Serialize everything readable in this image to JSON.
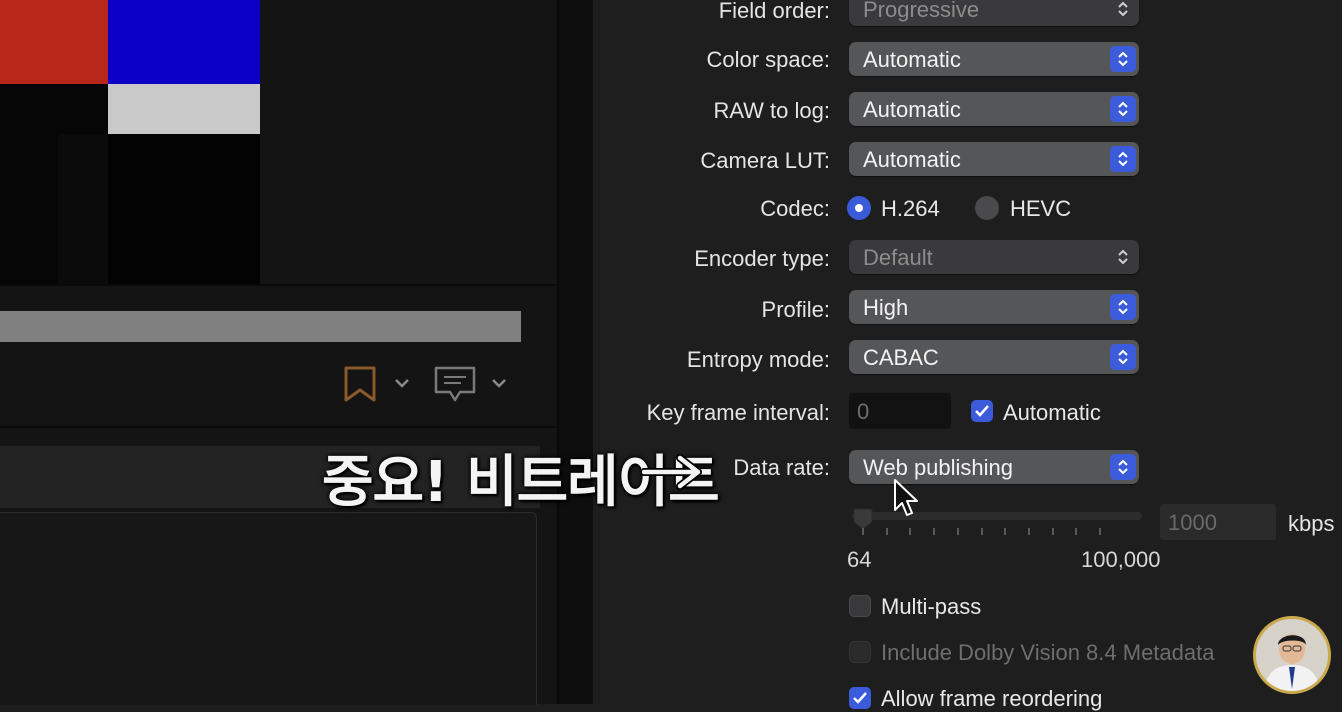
{
  "settings": {
    "field_order": {
      "label": "Field order:",
      "value": "Progressive"
    },
    "color_space": {
      "label": "Color space:",
      "value": "Automatic"
    },
    "raw_to_log": {
      "label": "RAW to log:",
      "value": "Automatic"
    },
    "camera_lut": {
      "label": "Camera LUT:",
      "value": "Automatic"
    },
    "codec": {
      "label": "Codec:",
      "options": [
        "H.264",
        "HEVC"
      ],
      "selected": "H.264"
    },
    "encoder_type": {
      "label": "Encoder type:",
      "value": "Default"
    },
    "profile": {
      "label": "Profile:",
      "value": "High"
    },
    "entropy_mode": {
      "label": "Entropy mode:",
      "value": "CABAC"
    },
    "key_frame_interval": {
      "label": "Key frame interval:",
      "value": "0",
      "automatic_label": "Automatic",
      "automatic_checked": true
    },
    "data_rate": {
      "label": "Data rate:",
      "value": "Web publishing",
      "field_value": "1000",
      "unit": "kbps",
      "min_label": "64",
      "max_label": "100,000"
    },
    "multi_pass": {
      "label": "Multi-pass",
      "checked": false
    },
    "dolby_vision": {
      "label": "Include Dolby Vision 8.4 Metadata",
      "checked": false
    },
    "frame_reordering": {
      "label": "Allow frame reordering",
      "checked": true
    }
  },
  "annotation": {
    "text": "중요! 비트레이트"
  },
  "colors": {
    "accent": "#3b5bdb",
    "swatch_red": "#b8281a",
    "swatch_blue": "#0c00c8",
    "swatch_white": "#c9c9c9",
    "bookmark": "#8a5a2a"
  },
  "icons": [
    "bookmark-icon",
    "chevron-down-icon",
    "comment-icon",
    "updown-chevron-icon",
    "checkmark-icon",
    "mouse-cursor-icon",
    "right-arrow-icon"
  ]
}
